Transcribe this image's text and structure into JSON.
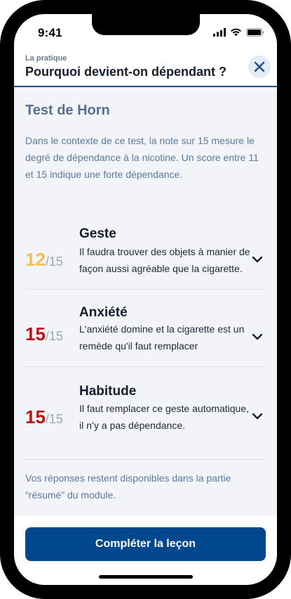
{
  "status_bar": {
    "time": "9:41"
  },
  "header": {
    "kicker": "La pratique",
    "title": "Pourquoi devient-on dépendant ?"
  },
  "section": {
    "title": "Test de Horn",
    "intro": "Dans le contexte de ce test, la note sur 15 mesure le degré de dépendance à la nicotine. Un score entre 11 et 15 indique une forte dépendance."
  },
  "results": [
    {
      "score": "12",
      "max": "/15",
      "score_color": "#f3c155",
      "title": "Geste",
      "description": "Il faudra trouver des objets à manier de façon aussi agréable que la cigarette."
    },
    {
      "score": "15",
      "max": "/15",
      "score_color": "#b8151b",
      "title": "Anxiété",
      "description": "L'anxiété domine et la cigarette est un remède qu'il faut remplacer"
    },
    {
      "score": "15",
      "max": "/15",
      "score_color": "#b8151b",
      "title": "Habitude",
      "description": "Il faut remplacer ce geste automatique, il n’y a pas dépendance."
    }
  ],
  "footnote": "Vos réponses restent disponibles dans la partie “résumé” du module.",
  "cta": {
    "label": "Compléter la leçon"
  },
  "colors": {
    "primary": "#00478e",
    "text_muted": "#5a7aa1"
  }
}
